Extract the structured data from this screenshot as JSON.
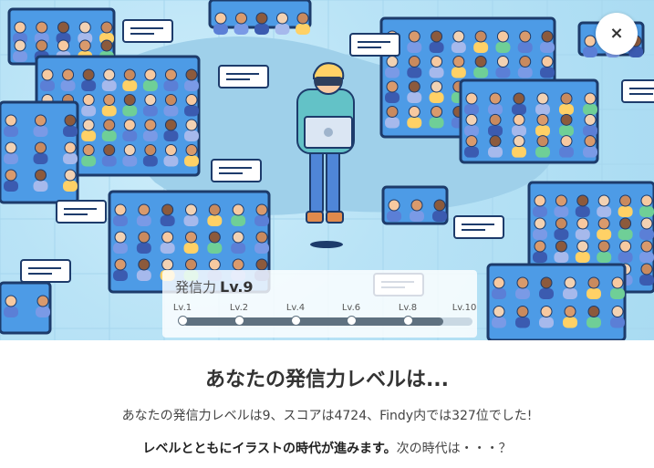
{
  "modal": {
    "close_label": "×",
    "heading": "あなたの発信力レベルは...",
    "summary": "あなたの発信力レベルは9、スコアは4724、Findy内では327位でした!",
    "era_bold": "レベルとともにイラストの時代が進みます。",
    "era_tail": "次の時代は・・・？"
  },
  "level_card": {
    "title": "発信力",
    "level": "Lv.9",
    "progress_fraction": 0.9,
    "ticks": [
      "Lv.1",
      "Lv.2",
      "Lv.4",
      "Lv.6",
      "Lv.8",
      "Lv.10"
    ]
  },
  "colors": {
    "hero_bg": "#b9e3f6",
    "frame": "#1d3b6b",
    "screen": "#4d9be6",
    "track": "#c9d8e3",
    "fill": "#5f7180"
  }
}
